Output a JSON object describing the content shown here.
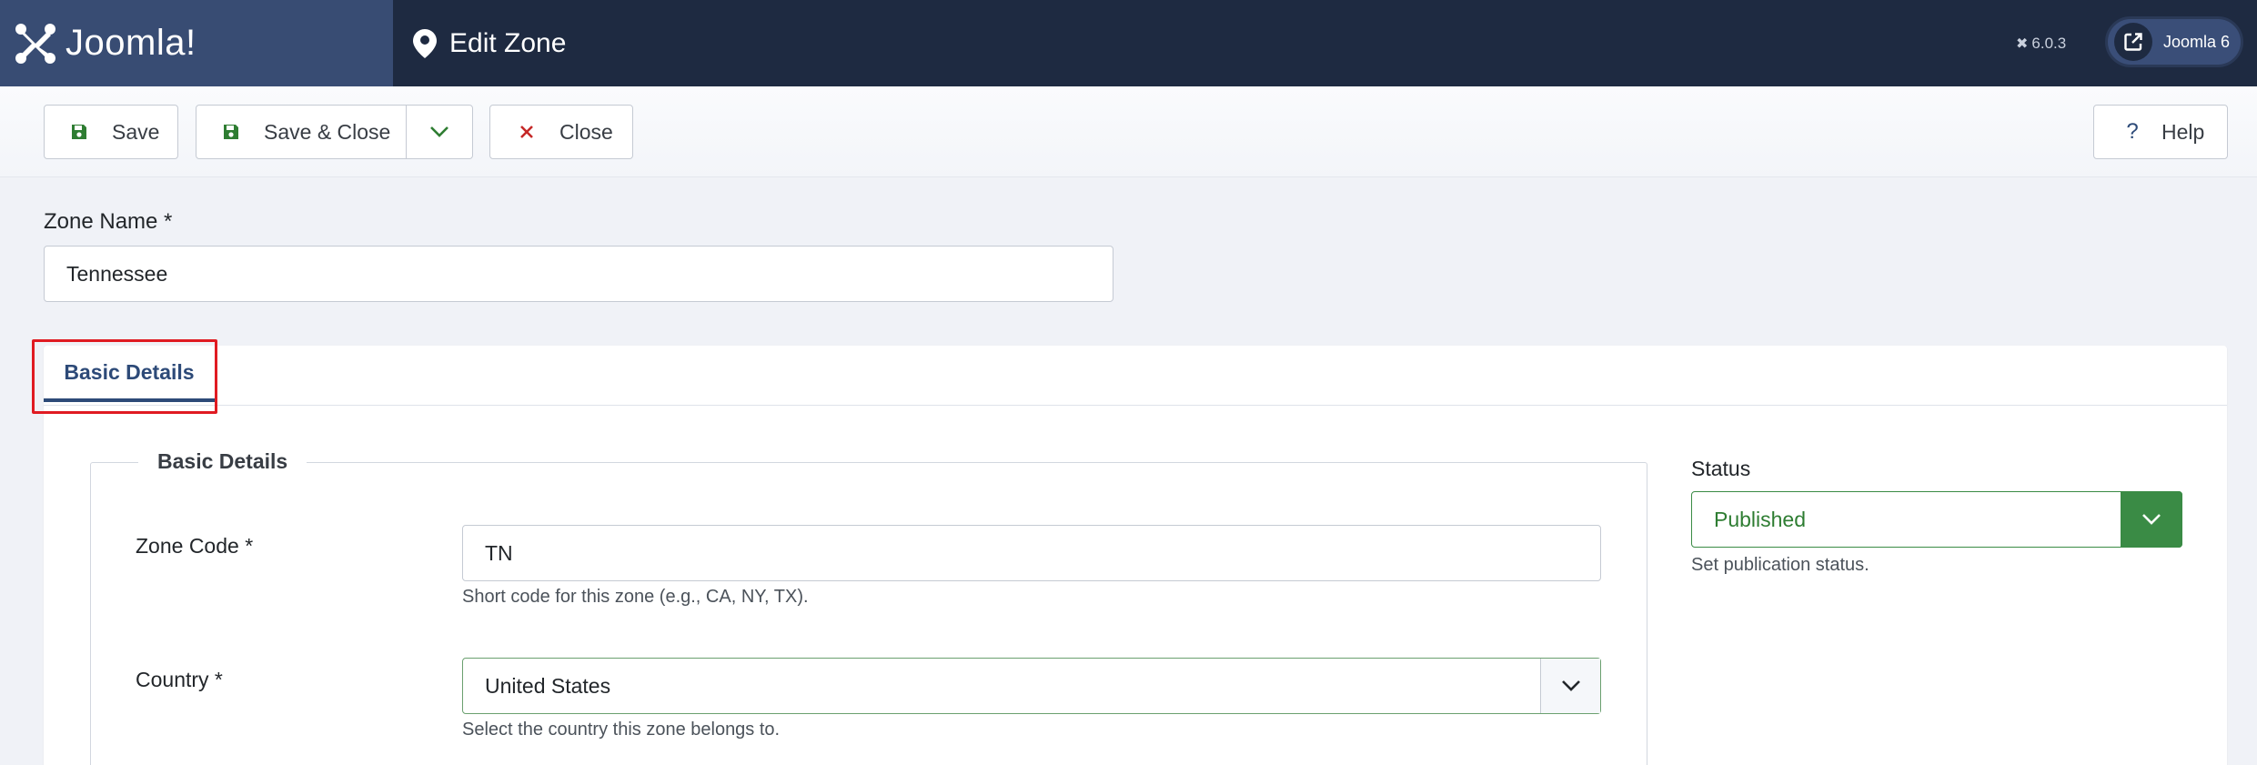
{
  "header": {
    "brand": "Joomla!",
    "page_title": "Edit Zone",
    "version": "6.0.3",
    "site_button_label": "Joomla 6"
  },
  "toolbar": {
    "save_label": "Save",
    "save_close_label": "Save & Close",
    "close_label": "Close",
    "help_label": "Help"
  },
  "form": {
    "zone_name_label": "Zone Name *",
    "zone_name_value": "Tennessee",
    "tabs": [
      {
        "label": "Basic Details",
        "active": true
      }
    ],
    "fieldset_legend": "Basic Details",
    "zone_code_label": "Zone Code *",
    "zone_code_value": "TN",
    "zone_code_hint": "Short code for this zone (e.g., CA, NY, TX).",
    "country_label": "Country *",
    "country_value": "United States",
    "country_hint": "Select the country this zone belongs to.",
    "status_label": "Status",
    "status_value": "Published",
    "status_hint": "Set publication status."
  },
  "colors": {
    "header_bg": "#1e2a41",
    "logo_bg": "#384c73",
    "status_green": "#3a8b45",
    "tab_accent": "#2d4a78",
    "highlight_red": "#e01b22"
  }
}
